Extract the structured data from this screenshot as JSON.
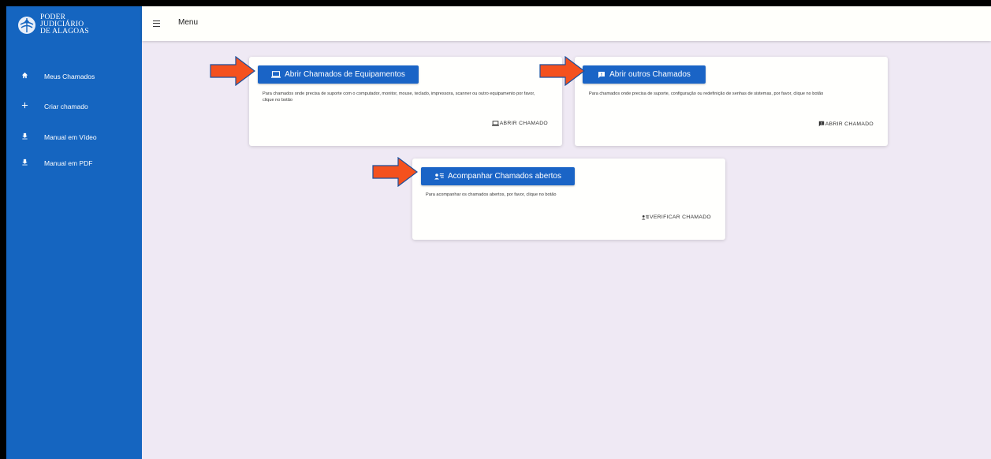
{
  "logo": {
    "line1": "PODER",
    "line2": "JUDICIÁRIO",
    "line3": "DE ALAGOAS"
  },
  "sidebar": {
    "items": [
      {
        "label": "Meus Chamados",
        "icon": "home-icon"
      },
      {
        "label": "Criar chamado",
        "icon": "plus-icon"
      },
      {
        "label": "Manual em Vídeo",
        "icon": "download-icon"
      },
      {
        "label": "Manual em PDF",
        "icon": "download-icon"
      }
    ]
  },
  "topbar": {
    "title": "Menu"
  },
  "cards": [
    {
      "button": "Abrir Chamados de Equipamentos",
      "button_icon": "laptop-icon",
      "description": "Para chamados onde precisa de suporte com o computador, monitor, mouse, teclado, impressora, scanner ou outro equipamento por favor, clique no botão",
      "action": "ABRIR CHAMADO",
      "action_icon": "laptop-icon"
    },
    {
      "button": "Abrir outros Chamados",
      "button_icon": "feedback-icon",
      "description": "Para chamados onde precisa de suporte, configuração ou redefinição de senhas de sistemas, por favor, clique no botão",
      "action": "ABRIR CHAMADO",
      "action_icon": "feedback-icon"
    },
    {
      "button": "Acompanhar Chamados abertos",
      "button_icon": "person-list-icon",
      "description": "Para acompanhar os chamados abertos, por favor, clique no botão",
      "action": "VERIFICAR CHAMADO",
      "action_icon": "person-list-icon"
    }
  ],
  "colors": {
    "sidebar": "#1565c0",
    "button": "#1a64c6",
    "background": "#efe9f4",
    "arrow": "#f4511e"
  }
}
